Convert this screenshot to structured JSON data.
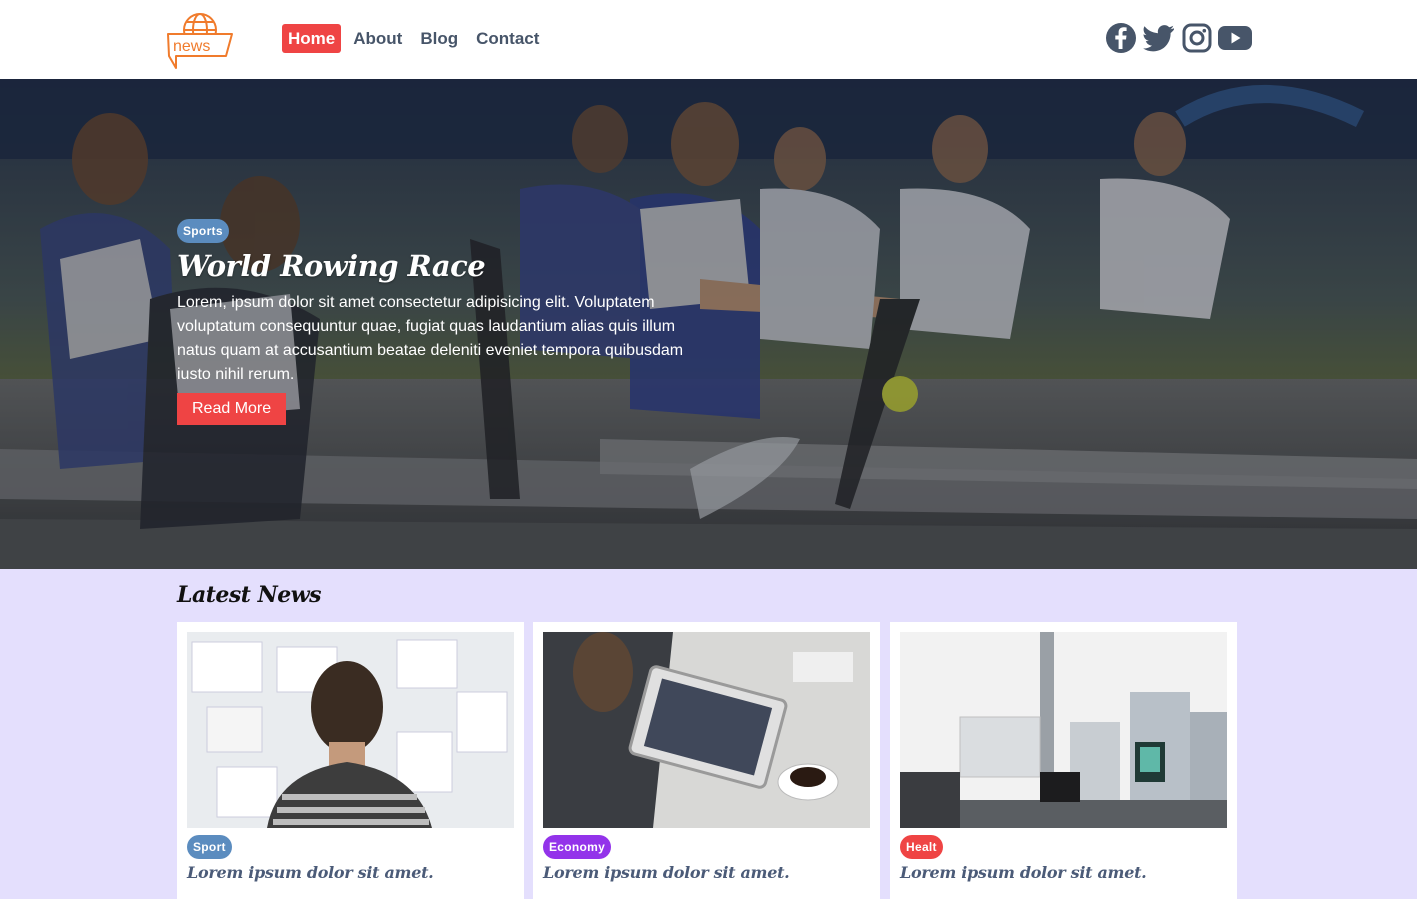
{
  "nav": {
    "logo_text": "news",
    "items": [
      {
        "label": "Home",
        "active": true
      },
      {
        "label": "About",
        "active": false
      },
      {
        "label": "Blog",
        "active": false
      },
      {
        "label": "Contact",
        "active": false
      }
    ]
  },
  "social": [
    "facebook-icon",
    "twitter-icon",
    "instagram-icon",
    "youtube-icon"
  ],
  "hero": {
    "category": "Sports",
    "title": "World Rowing Race",
    "text": "Lorem, ipsum dolor sit amet consectetur adipisicing elit. Voluptatem voluptatum consequuntur quae, fugiat quas laudantium alias quis illum natus quam at accusantium beatae deleniti eveniet tempora quibusdam iusto nihil rerum.",
    "button": "Read More"
  },
  "latest": {
    "title": "Latest News",
    "cards": [
      {
        "category": "Sport",
        "title": "Lorem ipsum dolor sit amet."
      },
      {
        "category": "Economy",
        "title": "Lorem ipsum dolor sit amet."
      },
      {
        "category": "Healt",
        "title": "Lorem ipsum dolor sit amet."
      }
    ]
  },
  "colors": {
    "accent": "#ef4444",
    "sport_badge": "#5b8cbf",
    "economy_badge": "#9333ea",
    "section_bg": "#e4dffd",
    "nav_text": "#475569"
  }
}
